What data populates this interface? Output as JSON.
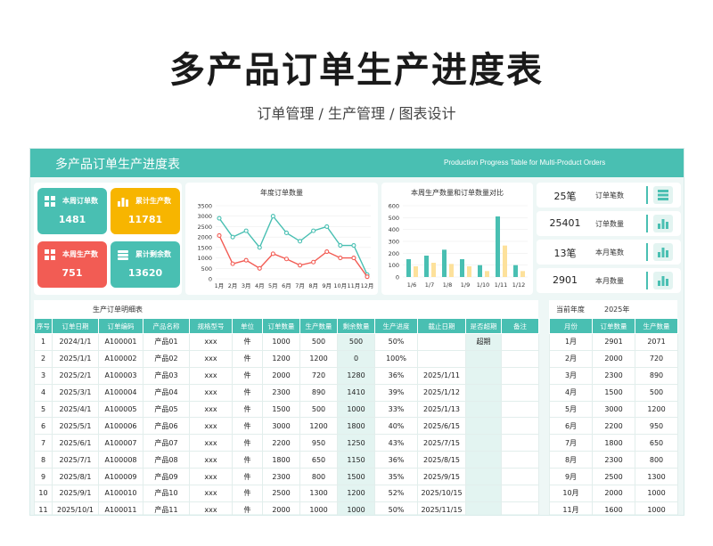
{
  "page": {
    "title": "多产品订单生产进度表",
    "subtitle": "订单管理 / 生产管理  / 图表设计"
  },
  "banner": {
    "title": "多产品订单生产进度表",
    "subtitle_en": "Production Progress Table for Multi-Product Orders",
    "color": "#49bfb2"
  },
  "kpis": [
    {
      "label": "本周订单数",
      "value": "1481",
      "color": "#49bfb2",
      "icon": "grid-icon"
    },
    {
      "label": "累计生产数",
      "value": "11781",
      "color": "#f7b500",
      "icon": "bar-chart-icon"
    },
    {
      "label": "本周生产数",
      "value": "751",
      "color": "#f25c54",
      "icon": "grid-icon"
    },
    {
      "label": "累计剩余数",
      "value": "13620",
      "color": "#49bfb2",
      "icon": "stack-icon"
    }
  ],
  "chart_data": [
    {
      "type": "line",
      "title": "年度订单数量",
      "categories": [
        "1月",
        "2月",
        "3月",
        "4月",
        "5月",
        "6月",
        "7月",
        "8月",
        "9月",
        "10月",
        "11月",
        "12月"
      ],
      "ylim": [
        0,
        3500
      ],
      "yticks": [
        "0",
        "500",
        "1000",
        "1500",
        "2000",
        "2500",
        "3000",
        "3500"
      ],
      "series": [
        {
          "color": "#49bfb2",
          "values": [
            2900,
            2000,
            2300,
            1500,
            3000,
            2200,
            1800,
            2300,
            2500,
            1600,
            1600,
            200
          ]
        },
        {
          "color": "#f25c54",
          "values": [
            2071,
            720,
            890,
            500,
            1200,
            950,
            650,
            800,
            1300,
            1000,
            1000,
            100
          ]
        }
      ],
      "grid": true
    },
    {
      "type": "bar",
      "title": "本周生产数量和订单数量对比",
      "categories": [
        "1/6",
        "1/7",
        "1/8",
        "1/9",
        "1/10",
        "1/11",
        "1/12"
      ],
      "ylim": [
        0,
        600
      ],
      "yticks": [
        "0",
        "100",
        "200",
        "300",
        "400",
        "500",
        "600"
      ],
      "series": [
        {
          "color": "#49bfb2",
          "values": [
            150,
            180,
            230,
            150,
            100,
            510,
            100
          ]
        },
        {
          "color": "#fde19b",
          "values": [
            90,
            120,
            110,
            90,
            50,
            265,
            50
          ]
        }
      ],
      "grid": true
    }
  ],
  "stats": [
    {
      "value": "25笔",
      "label": "订单笔数",
      "icon": "stack-icon"
    },
    {
      "value": "25401",
      "label": "订单数量",
      "icon": "bar-chart-icon"
    },
    {
      "value": "13笔",
      "label": "本月笔数",
      "icon": "bar-chart-icon"
    },
    {
      "value": "2901",
      "label": "本月数量",
      "icon": "bar-chart-icon"
    }
  ],
  "detail_table": {
    "title": "生产订单明细表",
    "headers": [
      "序号",
      "订单日期",
      "订单编码",
      "产品名称",
      "规格型号",
      "单位",
      "订单数量",
      "生产数量",
      "剩余数量",
      "生产进度",
      "截止日期",
      "是否超期",
      "备注"
    ],
    "rows": [
      [
        "1",
        "2024/1/1",
        "A100001",
        "产品01",
        "xxx",
        "件",
        "1000",
        "500",
        "500",
        "50%",
        "",
        "超期",
        ""
      ],
      [
        "2",
        "2025/1/1",
        "A100002",
        "产品02",
        "xxx",
        "件",
        "1200",
        "1200",
        "0",
        "100%",
        "",
        "",
        ""
      ],
      [
        "3",
        "2025/2/1",
        "A100003",
        "产品03",
        "xxx",
        "件",
        "2000",
        "720",
        "1280",
        "36%",
        "2025/1/11",
        "",
        ""
      ],
      [
        "4",
        "2025/3/1",
        "A100004",
        "产品04",
        "xxx",
        "件",
        "2300",
        "890",
        "1410",
        "39%",
        "2025/1/12",
        "",
        ""
      ],
      [
        "5",
        "2025/4/1",
        "A100005",
        "产品05",
        "xxx",
        "件",
        "1500",
        "500",
        "1000",
        "33%",
        "2025/1/13",
        "",
        ""
      ],
      [
        "6",
        "2025/5/1",
        "A100006",
        "产品06",
        "xxx",
        "件",
        "3000",
        "1200",
        "1800",
        "40%",
        "2025/6/15",
        "",
        ""
      ],
      [
        "7",
        "2025/6/1",
        "A100007",
        "产品07",
        "xxx",
        "件",
        "2200",
        "950",
        "1250",
        "43%",
        "2025/7/15",
        "",
        ""
      ],
      [
        "8",
        "2025/7/1",
        "A100008",
        "产品08",
        "xxx",
        "件",
        "1800",
        "650",
        "1150",
        "36%",
        "2025/8/15",
        "",
        ""
      ],
      [
        "9",
        "2025/8/1",
        "A100009",
        "产品09",
        "xxx",
        "件",
        "2300",
        "800",
        "1500",
        "35%",
        "2025/9/15",
        "",
        ""
      ],
      [
        "10",
        "2025/9/1",
        "A100010",
        "产品10",
        "xxx",
        "件",
        "2500",
        "1300",
        "1200",
        "52%",
        "2025/10/15",
        "",
        ""
      ],
      [
        "11",
        "2025/10/1",
        "A100011",
        "产品11",
        "xxx",
        "件",
        "2000",
        "1000",
        "1000",
        "50%",
        "2025/11/15",
        "",
        ""
      ]
    ]
  },
  "year_table": {
    "year_label": "当前年度",
    "year_value": "2025年",
    "headers": [
      "月份",
      "订单数量",
      "生产数量"
    ],
    "rows": [
      [
        "1月",
        "2901",
        "2071"
      ],
      [
        "2月",
        "2000",
        "720"
      ],
      [
        "3月",
        "2300",
        "890"
      ],
      [
        "4月",
        "1500",
        "500"
      ],
      [
        "5月",
        "3000",
        "1200"
      ],
      [
        "6月",
        "2200",
        "950"
      ],
      [
        "7月",
        "1800",
        "650"
      ],
      [
        "8月",
        "2300",
        "800"
      ],
      [
        "9月",
        "2500",
        "1300"
      ],
      [
        "10月",
        "2000",
        "1000"
      ],
      [
        "11月",
        "1600",
        "1000"
      ]
    ]
  }
}
